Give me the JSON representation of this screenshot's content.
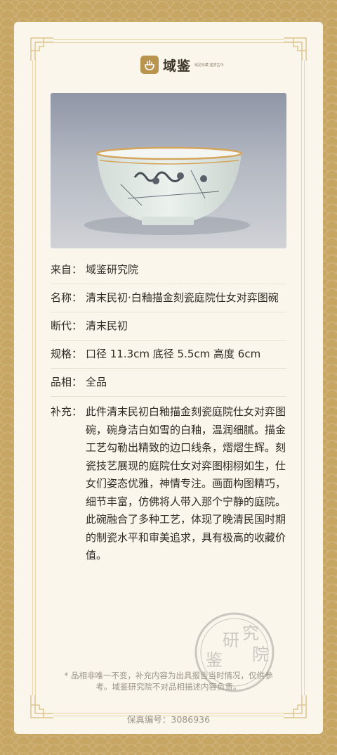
{
  "brand": {
    "name": "域鉴",
    "tagline": "域见珍藏 鉴赏古今"
  },
  "photo": {
    "subject": "porcelain-bowl"
  },
  "details": [
    {
      "key": "来自：",
      "value": "域鉴研究院"
    },
    {
      "key": "名称：",
      "value": "清末民初·白釉描金刻瓷庭院仕女对弈图碗"
    },
    {
      "key": "断代：",
      "value": "清末民初"
    },
    {
      "key": "规格：",
      "value": "口径 11.3cm 底径 5.5cm 高度 6cm"
    },
    {
      "key": "品相：",
      "value": "全品"
    },
    {
      "key": "补充：",
      "value": "此件清末民初白釉描金刻瓷庭院仕女对弈图碗，碗身洁白如雪的白釉，温润细腻。描金工艺勾勒出精致的边口线条，熠熠生辉。刻瓷技艺展现的庭院仕女对弈图栩栩如生，仕女们姿态优雅，神情专注。画面构图精巧，细节丰富，仿佛将人带入那个宁静的庭院。此碗融合了多种工艺，体现了晚清民国时期的制瓷水平和审美追求，具有极高的收藏价值。"
    }
  ],
  "stamp": {
    "text": "研究院 鉴"
  },
  "note": "* 品相非唯一不变，补充内容为出具报告当时情况，仅供参考。域鉴研究院不对品相描述内容负责。",
  "serial": "保真编号：3086936",
  "colors": {
    "background_gold": "#c7a664",
    "card": "#faf6ec",
    "logo_gold": "#b8944f",
    "text_dark": "#2e2a24",
    "text_muted": "#9a9386"
  }
}
